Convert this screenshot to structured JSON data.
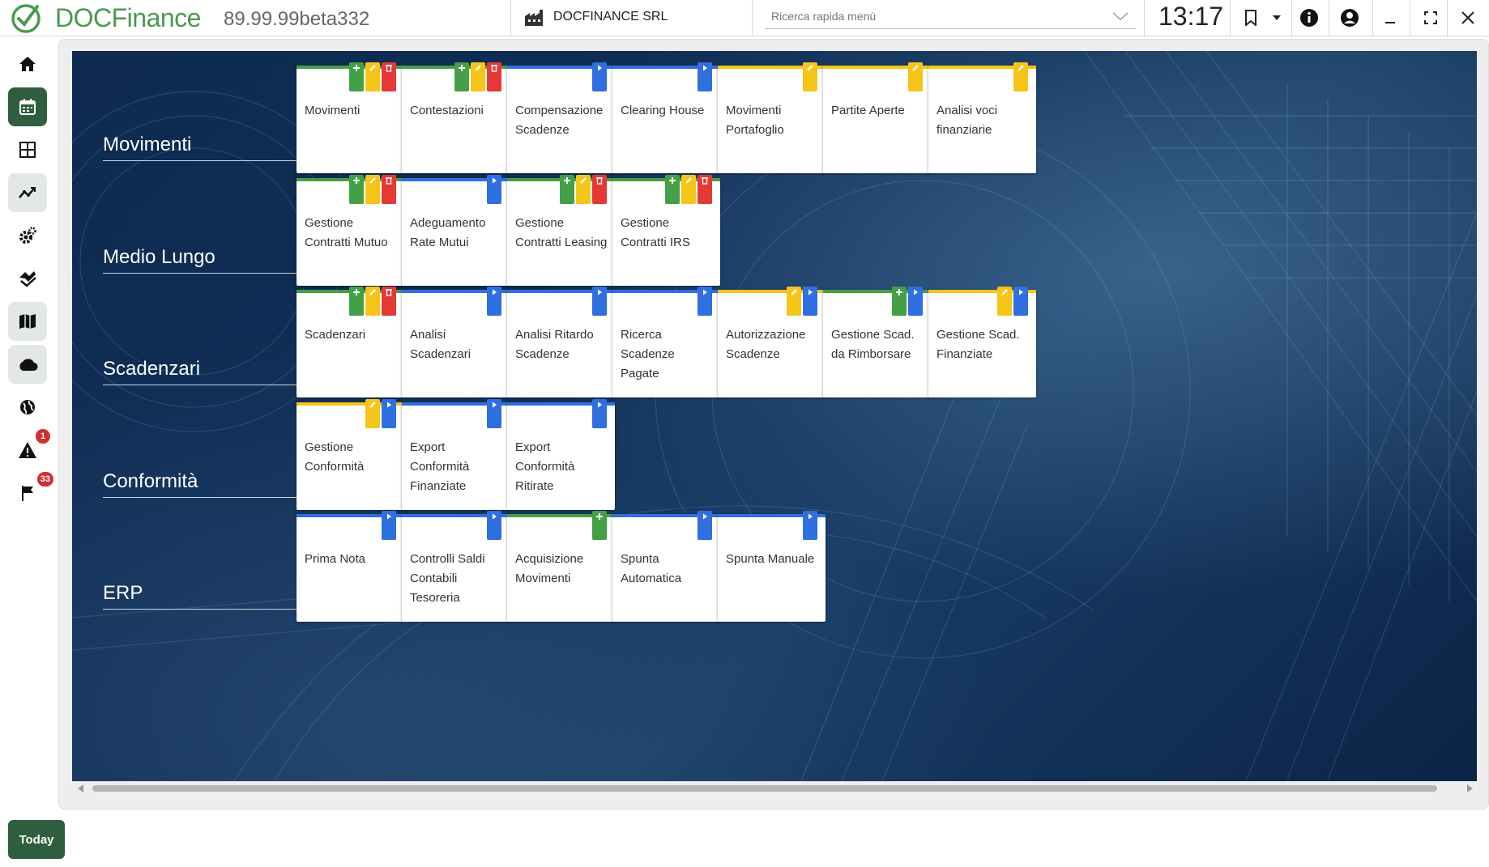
{
  "app": {
    "brand_prefix": "DOC",
    "brand_suffix": "Finance",
    "version": "89.99.99beta332",
    "company": "DOCFINANCE SRL",
    "search_placeholder": "Ricerca rapida menù",
    "clock": "13:17",
    "accent_color": "#2f5e3f",
    "brand_color": "#4a9a4e"
  },
  "topbar_icons": [
    "building-icon",
    "chevron-down-icon",
    "bookmark-icon",
    "caret-down-icon",
    "info-icon",
    "account-icon",
    "minimize-icon",
    "fullscreen-icon",
    "close-icon"
  ],
  "sidebar": {
    "items": [
      {
        "icon": "home-icon",
        "state": "normal"
      },
      {
        "icon": "calendar-icon",
        "state": "active"
      },
      {
        "icon": "grid-icon",
        "state": "normal"
      },
      {
        "icon": "trend-chart-icon",
        "state": "light"
      },
      {
        "icon": "settings-gear-icon",
        "state": "normal"
      },
      {
        "icon": "handshake-icon",
        "state": "normal"
      },
      {
        "icon": "book-map-icon",
        "state": "light"
      },
      {
        "icon": "cloud-icon",
        "state": "light"
      },
      {
        "icon": "globe-icon",
        "state": "normal"
      },
      {
        "icon": "warning-icon",
        "state": "normal",
        "badge": "1"
      },
      {
        "icon": "flag-icon",
        "state": "normal",
        "badge": "33"
      }
    ],
    "today_label": "Today"
  },
  "sections": [
    {
      "title": "Movimenti",
      "tiles": [
        {
          "label": "Movimenti",
          "bar": "green",
          "flags": [
            "green",
            "yellow",
            "red"
          ]
        },
        {
          "label": "Contestazioni",
          "bar": "green",
          "flags": [
            "green",
            "yellow",
            "red"
          ]
        },
        {
          "label": "Compensazione Scadenze",
          "bar": "blue",
          "flags": [
            "blue"
          ]
        },
        {
          "label": "Clearing House",
          "bar": "blue",
          "flags": [
            "blue"
          ]
        },
        {
          "label": "Movimenti Portafoglio",
          "bar": "yellow",
          "flags": [
            "yellow"
          ]
        },
        {
          "label": "Partite Aperte",
          "bar": "yellow",
          "flags": [
            "yellow"
          ]
        },
        {
          "label": "Analisi voci finanziarie",
          "bar": "yellow",
          "flags": [
            "yellow"
          ]
        }
      ]
    },
    {
      "title": "Medio Lungo",
      "tiles": [
        {
          "label": "Gestione Contratti Mutuo",
          "bar": "green",
          "flags": [
            "green",
            "yellow",
            "red"
          ]
        },
        {
          "label": "Adeguamento Rate Mutui",
          "bar": "blue",
          "flags": [
            "blue"
          ]
        },
        {
          "label": "Gestione Contratti Leasing",
          "bar": "green",
          "flags": [
            "green",
            "yellow",
            "red"
          ]
        },
        {
          "label": "Gestione Contratti IRS",
          "bar": "green",
          "flags": [
            "green",
            "yellow",
            "red"
          ]
        }
      ]
    },
    {
      "title": "Scadenzari",
      "tiles": [
        {
          "label": "Scadenzari",
          "bar": "green",
          "flags": [
            "green",
            "yellow",
            "red"
          ]
        },
        {
          "label": "Analisi Scadenzari",
          "bar": "blue",
          "flags": [
            "blue"
          ]
        },
        {
          "label": "Analisi Ritardo Scadenze",
          "bar": "blue",
          "flags": [
            "blue"
          ]
        },
        {
          "label": "Ricerca Scadenze Pagate",
          "bar": "blue",
          "flags": [
            "blue"
          ]
        },
        {
          "label": "Autorizzazione Scadenze",
          "bar": "yellow",
          "flags": [
            "yellow",
            "blue"
          ]
        },
        {
          "label": "Gestione Scad. da Rimborsare",
          "bar": "green",
          "flags": [
            "green",
            "blue"
          ]
        },
        {
          "label": "Gestione Scad. Finanziate",
          "bar": "yellow",
          "flags": [
            "yellow",
            "blue"
          ]
        }
      ]
    },
    {
      "title": "Conformità",
      "tiles": [
        {
          "label": "Gestione Conformità",
          "bar": "yellow",
          "flags": [
            "yellow",
            "blue"
          ]
        },
        {
          "label": "Export Conformità Finanziate",
          "bar": "blue",
          "flags": [
            "blue"
          ]
        },
        {
          "label": "Export Conformità Ritirate",
          "bar": "blue",
          "flags": [
            "blue"
          ]
        }
      ]
    },
    {
      "title": "ERP",
      "tiles": [
        {
          "label": "Prima Nota",
          "bar": "blue",
          "flags": [
            "blue"
          ]
        },
        {
          "label": "Controlli Saldi Contabili Tesoreria",
          "bar": "blue",
          "flags": [
            "blue"
          ]
        },
        {
          "label": "Acquisizione Movimenti",
          "bar": "green",
          "flags": [
            "green"
          ]
        },
        {
          "label": "Spunta Automatica",
          "bar": "blue",
          "flags": [
            "blue"
          ]
        },
        {
          "label": "Spunta Manuale",
          "bar": "blue",
          "flags": [
            "blue"
          ]
        }
      ]
    }
  ],
  "colors": {
    "green": "#43a047",
    "yellow": "#f5c518",
    "red": "#e53935",
    "blue": "#2f6fe0"
  }
}
